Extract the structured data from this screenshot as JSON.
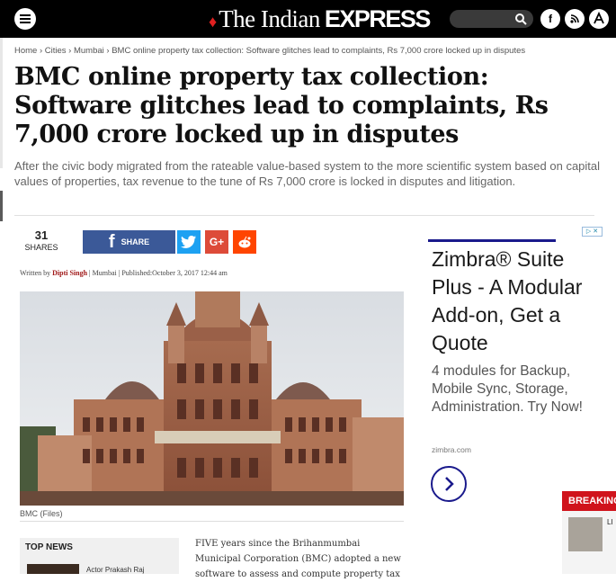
{
  "header": {
    "logo_prefix": "The Indian",
    "logo_bold": "EXPRESS",
    "menu_icon": "hamburger-icon",
    "search_icon": "search-icon",
    "social": [
      "f",
      "rss",
      "A"
    ]
  },
  "breadcrumb": "Home › Cities › Mumbai › BMC online property tax collection: Software glitches lead to complaints, Rs 7,000 crore locked up in disputes",
  "article": {
    "headline": "BMC online property tax collection: Software glitches lead to complaints, Rs 7,000 crore locked up in disputes",
    "summary": "After the civic body migrated from the rateable value-based system to the more scientific system based on capital values of properties, tax revenue to the tune of Rs 7,000 crore is locked in disputes and litigation.",
    "shares_count": "31",
    "shares_label": "SHARES",
    "fb_share_label": "SHARE",
    "twitter_label": "t",
    "gplus_label": "G+",
    "reddit_label": "reddit",
    "byline_written": "Written by ",
    "byline_author": "Dipti Singh",
    "byline_rest": " | Mumbai | Published:October 3, 2017 12:44 am",
    "photo_caption": "BMC (Files)",
    "body_lead": "FIVE years since the Brihanmumbai Municipal Corporation (BMC) adopted a new software to assess and compute property tax"
  },
  "top_news": {
    "heading": "TOP NEWS",
    "item": "Actor Prakash Raj"
  },
  "ad": {
    "choices": "▷ ✕",
    "title": "Zimbra® Suite Plus - A Modular Add-on, Get a Quote",
    "description": "4 modules for Backup, Mobile Sync, Storage, Administration. Try Now!",
    "domain": "zimbra.com"
  },
  "breaking": {
    "label": "BREAKING",
    "text": "LI"
  },
  "colors": {
    "header_bg": "#000000",
    "facebook": "#3b5998",
    "twitter": "#1da1f2",
    "gplus": "#dd4b39",
    "reddit": "#ff4500",
    "breaking": "#d0131c",
    "ad_accent": "#1a1a8c"
  }
}
